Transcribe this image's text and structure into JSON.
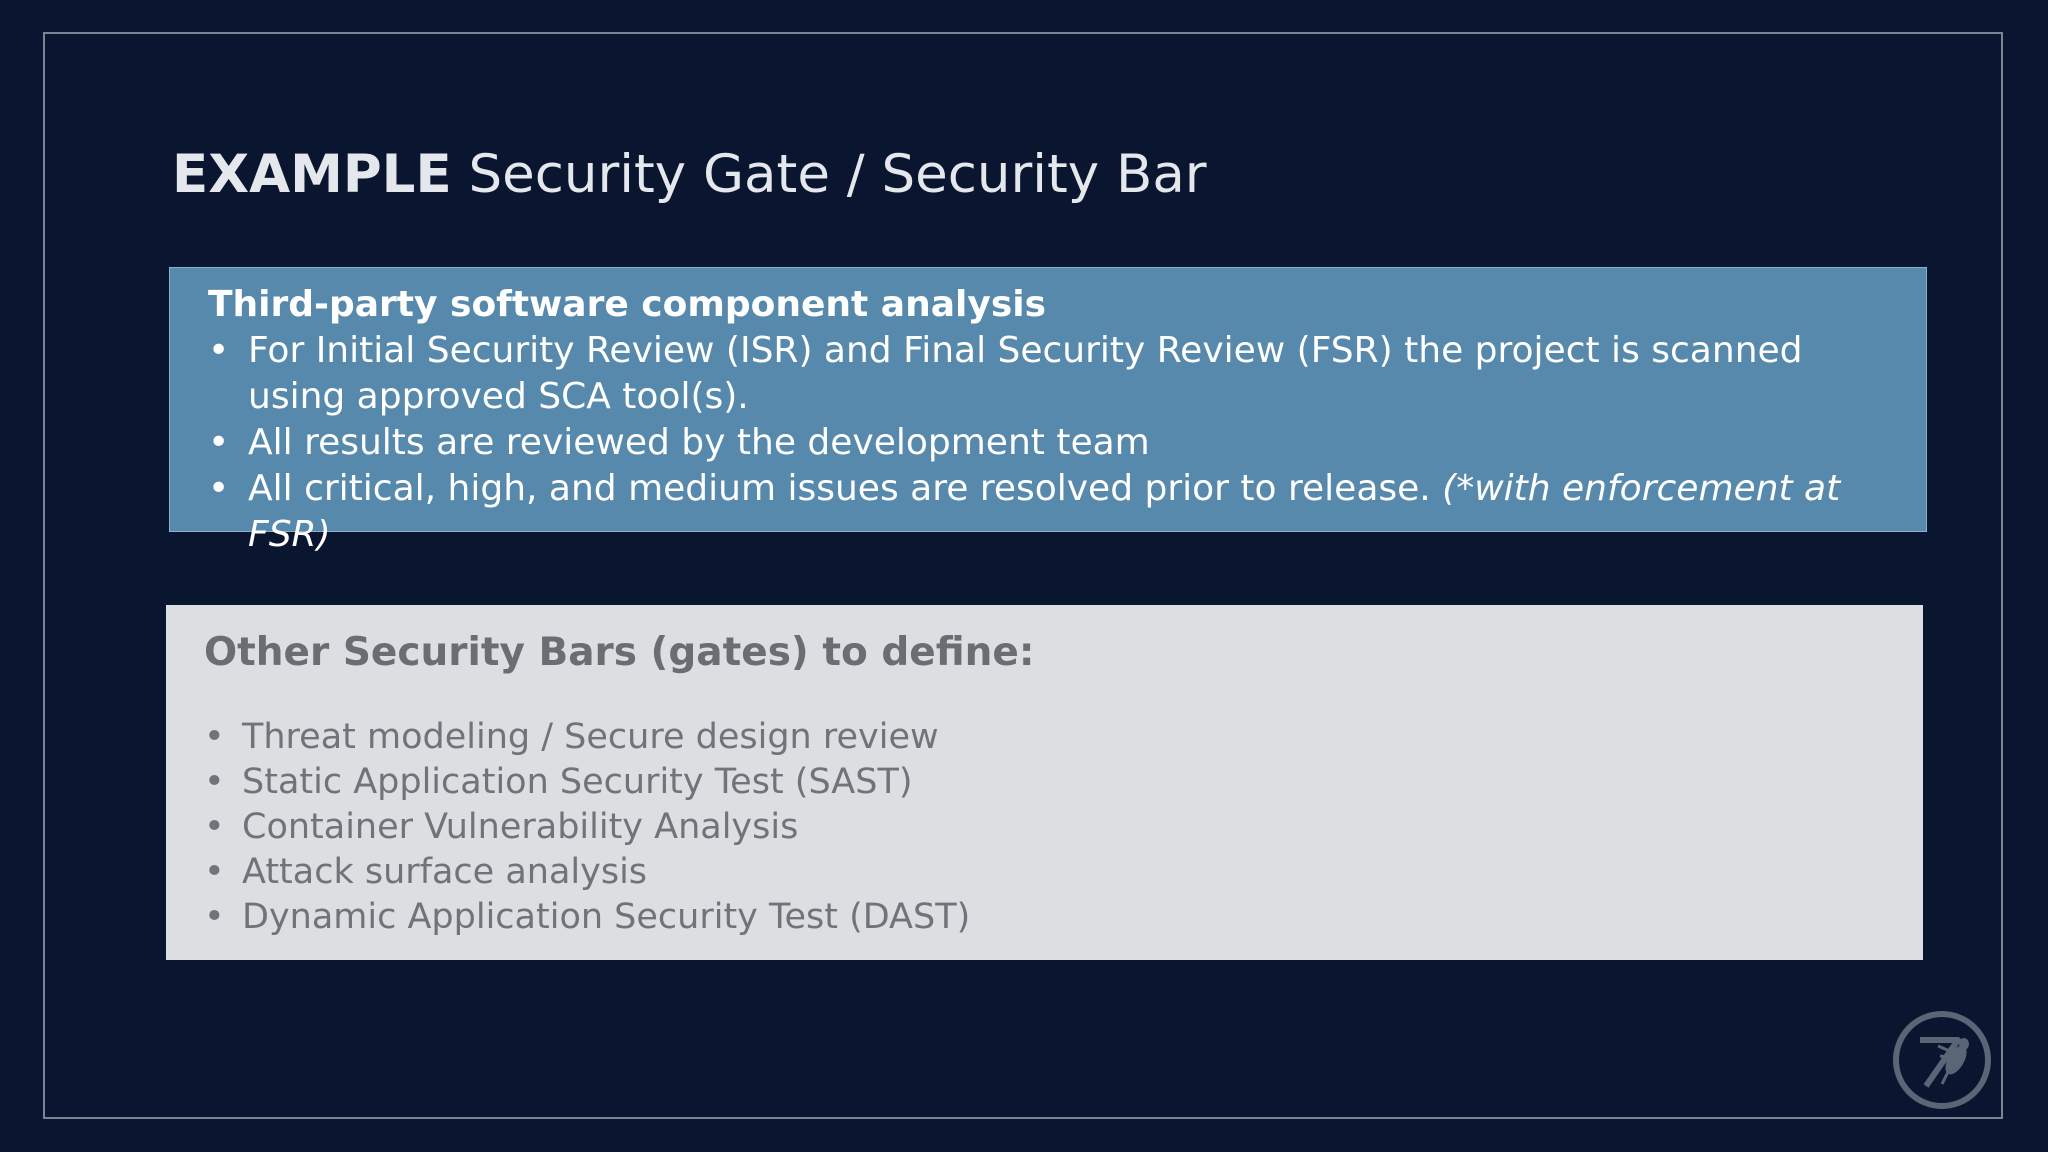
{
  "slide": {
    "title_bold": "EXAMPLE",
    "title_rest": " Security Gate / Security Bar",
    "primary_box": {
      "heading": "Third-party software component analysis",
      "bullets": [
        {
          "text": "For Initial Security Review (ISR) and Final Security Review (FSR) the project is scanned using approved SCA tool(s).",
          "note": ""
        },
        {
          "text": "All results are reviewed by the development team",
          "note": ""
        },
        {
          "text": "All critical, high, and medium issues are resolved prior to release. ",
          "note": "(*with enforcement at FSR)"
        }
      ]
    },
    "secondary_box": {
      "heading": "Other Security Bars (gates) to define:",
      "bullets": [
        "Threat modeling / Secure design review",
        "Static Application Security Test (SAST)",
        "Container Vulnerability Analysis",
        "Attack surface analysis",
        "Dynamic Application Security Test (DAST)"
      ]
    },
    "colors": {
      "background": "#0a1530",
      "primary_box": "#5789ad",
      "secondary_box": "#dcdfe2",
      "title_text": "#e4e7ec"
    },
    "logo_icon": "wasp-logo-icon"
  }
}
